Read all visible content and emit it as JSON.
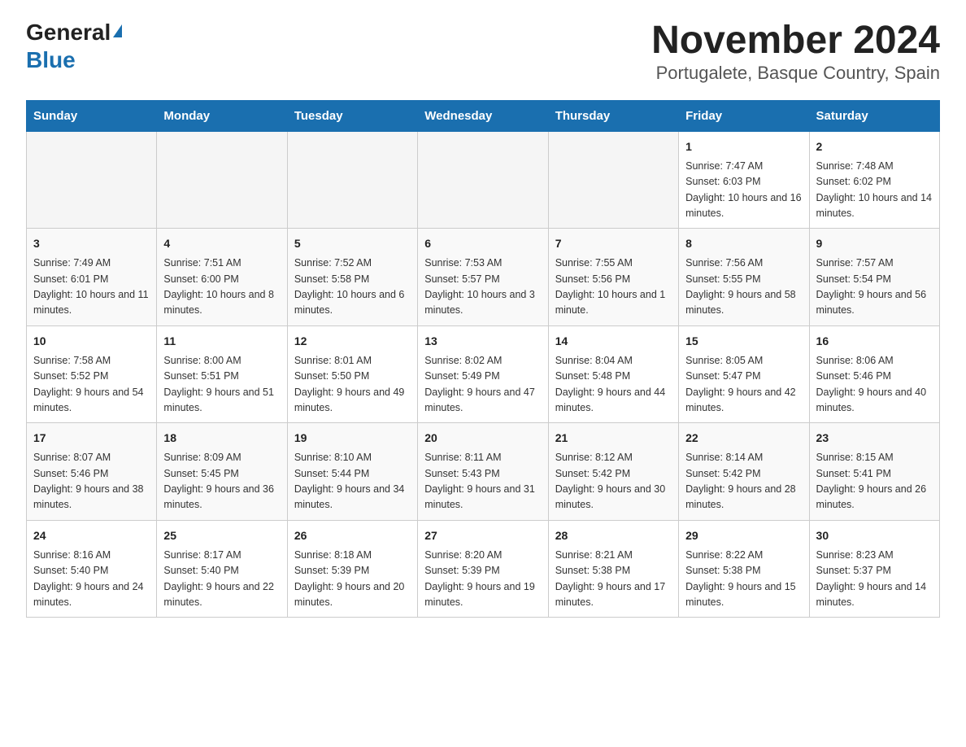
{
  "header": {
    "title": "November 2024",
    "subtitle": "Portugalete, Basque Country, Spain",
    "logo_general": "General",
    "logo_blue": "Blue"
  },
  "days_of_week": [
    "Sunday",
    "Monday",
    "Tuesday",
    "Wednesday",
    "Thursday",
    "Friday",
    "Saturday"
  ],
  "weeks": [
    [
      {
        "day": "",
        "sunrise": "",
        "sunset": "",
        "daylight": "",
        "empty": true
      },
      {
        "day": "",
        "sunrise": "",
        "sunset": "",
        "daylight": "",
        "empty": true
      },
      {
        "day": "",
        "sunrise": "",
        "sunset": "",
        "daylight": "",
        "empty": true
      },
      {
        "day": "",
        "sunrise": "",
        "sunset": "",
        "daylight": "",
        "empty": true
      },
      {
        "day": "",
        "sunrise": "",
        "sunset": "",
        "daylight": "",
        "empty": true
      },
      {
        "day": "1",
        "sunrise": "Sunrise: 7:47 AM",
        "sunset": "Sunset: 6:03 PM",
        "daylight": "Daylight: 10 hours and 16 minutes.",
        "empty": false
      },
      {
        "day": "2",
        "sunrise": "Sunrise: 7:48 AM",
        "sunset": "Sunset: 6:02 PM",
        "daylight": "Daylight: 10 hours and 14 minutes.",
        "empty": false
      }
    ],
    [
      {
        "day": "3",
        "sunrise": "Sunrise: 7:49 AM",
        "sunset": "Sunset: 6:01 PM",
        "daylight": "Daylight: 10 hours and 11 minutes.",
        "empty": false
      },
      {
        "day": "4",
        "sunrise": "Sunrise: 7:51 AM",
        "sunset": "Sunset: 6:00 PM",
        "daylight": "Daylight: 10 hours and 8 minutes.",
        "empty": false
      },
      {
        "day": "5",
        "sunrise": "Sunrise: 7:52 AM",
        "sunset": "Sunset: 5:58 PM",
        "daylight": "Daylight: 10 hours and 6 minutes.",
        "empty": false
      },
      {
        "day": "6",
        "sunrise": "Sunrise: 7:53 AM",
        "sunset": "Sunset: 5:57 PM",
        "daylight": "Daylight: 10 hours and 3 minutes.",
        "empty": false
      },
      {
        "day": "7",
        "sunrise": "Sunrise: 7:55 AM",
        "sunset": "Sunset: 5:56 PM",
        "daylight": "Daylight: 10 hours and 1 minute.",
        "empty": false
      },
      {
        "day": "8",
        "sunrise": "Sunrise: 7:56 AM",
        "sunset": "Sunset: 5:55 PM",
        "daylight": "Daylight: 9 hours and 58 minutes.",
        "empty": false
      },
      {
        "day": "9",
        "sunrise": "Sunrise: 7:57 AM",
        "sunset": "Sunset: 5:54 PM",
        "daylight": "Daylight: 9 hours and 56 minutes.",
        "empty": false
      }
    ],
    [
      {
        "day": "10",
        "sunrise": "Sunrise: 7:58 AM",
        "sunset": "Sunset: 5:52 PM",
        "daylight": "Daylight: 9 hours and 54 minutes.",
        "empty": false
      },
      {
        "day": "11",
        "sunrise": "Sunrise: 8:00 AM",
        "sunset": "Sunset: 5:51 PM",
        "daylight": "Daylight: 9 hours and 51 minutes.",
        "empty": false
      },
      {
        "day": "12",
        "sunrise": "Sunrise: 8:01 AM",
        "sunset": "Sunset: 5:50 PM",
        "daylight": "Daylight: 9 hours and 49 minutes.",
        "empty": false
      },
      {
        "day": "13",
        "sunrise": "Sunrise: 8:02 AM",
        "sunset": "Sunset: 5:49 PM",
        "daylight": "Daylight: 9 hours and 47 minutes.",
        "empty": false
      },
      {
        "day": "14",
        "sunrise": "Sunrise: 8:04 AM",
        "sunset": "Sunset: 5:48 PM",
        "daylight": "Daylight: 9 hours and 44 minutes.",
        "empty": false
      },
      {
        "day": "15",
        "sunrise": "Sunrise: 8:05 AM",
        "sunset": "Sunset: 5:47 PM",
        "daylight": "Daylight: 9 hours and 42 minutes.",
        "empty": false
      },
      {
        "day": "16",
        "sunrise": "Sunrise: 8:06 AM",
        "sunset": "Sunset: 5:46 PM",
        "daylight": "Daylight: 9 hours and 40 minutes.",
        "empty": false
      }
    ],
    [
      {
        "day": "17",
        "sunrise": "Sunrise: 8:07 AM",
        "sunset": "Sunset: 5:46 PM",
        "daylight": "Daylight: 9 hours and 38 minutes.",
        "empty": false
      },
      {
        "day": "18",
        "sunrise": "Sunrise: 8:09 AM",
        "sunset": "Sunset: 5:45 PM",
        "daylight": "Daylight: 9 hours and 36 minutes.",
        "empty": false
      },
      {
        "day": "19",
        "sunrise": "Sunrise: 8:10 AM",
        "sunset": "Sunset: 5:44 PM",
        "daylight": "Daylight: 9 hours and 34 minutes.",
        "empty": false
      },
      {
        "day": "20",
        "sunrise": "Sunrise: 8:11 AM",
        "sunset": "Sunset: 5:43 PM",
        "daylight": "Daylight: 9 hours and 31 minutes.",
        "empty": false
      },
      {
        "day": "21",
        "sunrise": "Sunrise: 8:12 AM",
        "sunset": "Sunset: 5:42 PM",
        "daylight": "Daylight: 9 hours and 30 minutes.",
        "empty": false
      },
      {
        "day": "22",
        "sunrise": "Sunrise: 8:14 AM",
        "sunset": "Sunset: 5:42 PM",
        "daylight": "Daylight: 9 hours and 28 minutes.",
        "empty": false
      },
      {
        "day": "23",
        "sunrise": "Sunrise: 8:15 AM",
        "sunset": "Sunset: 5:41 PM",
        "daylight": "Daylight: 9 hours and 26 minutes.",
        "empty": false
      }
    ],
    [
      {
        "day": "24",
        "sunrise": "Sunrise: 8:16 AM",
        "sunset": "Sunset: 5:40 PM",
        "daylight": "Daylight: 9 hours and 24 minutes.",
        "empty": false
      },
      {
        "day": "25",
        "sunrise": "Sunrise: 8:17 AM",
        "sunset": "Sunset: 5:40 PM",
        "daylight": "Daylight: 9 hours and 22 minutes.",
        "empty": false
      },
      {
        "day": "26",
        "sunrise": "Sunrise: 8:18 AM",
        "sunset": "Sunset: 5:39 PM",
        "daylight": "Daylight: 9 hours and 20 minutes.",
        "empty": false
      },
      {
        "day": "27",
        "sunrise": "Sunrise: 8:20 AM",
        "sunset": "Sunset: 5:39 PM",
        "daylight": "Daylight: 9 hours and 19 minutes.",
        "empty": false
      },
      {
        "day": "28",
        "sunrise": "Sunrise: 8:21 AM",
        "sunset": "Sunset: 5:38 PM",
        "daylight": "Daylight: 9 hours and 17 minutes.",
        "empty": false
      },
      {
        "day": "29",
        "sunrise": "Sunrise: 8:22 AM",
        "sunset": "Sunset: 5:38 PM",
        "daylight": "Daylight: 9 hours and 15 minutes.",
        "empty": false
      },
      {
        "day": "30",
        "sunrise": "Sunrise: 8:23 AM",
        "sunset": "Sunset: 5:37 PM",
        "daylight": "Daylight: 9 hours and 14 minutes.",
        "empty": false
      }
    ]
  ]
}
